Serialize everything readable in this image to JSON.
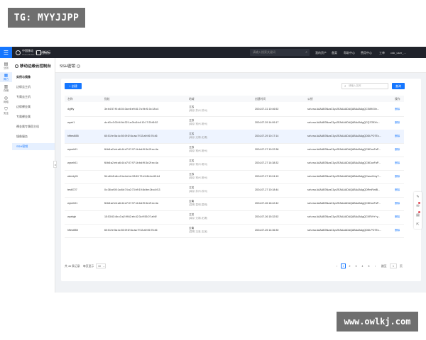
{
  "watermarks": {
    "top": "TG: MYYJJPP",
    "bottom": "www.owlkj.com"
  },
  "topbar": {
    "logo_text": "中国移动",
    "logo_sub": "China Mobile",
    "logo_text2": "移动云",
    "console_label": "控制台",
    "search_placeholder": "请输入搜索关键词",
    "nav": [
      "我的资产",
      "备案",
      "帮助中心",
      "费用中心",
      "工单"
    ],
    "user": "csb_user_..."
  },
  "iconbar": {
    "items": [
      {
        "label": "业务",
        "icon": "document-icon"
      },
      {
        "label": "算力",
        "icon": "server-icon"
      },
      {
        "label": "存储",
        "icon": "storage-icon"
      },
      {
        "label": "网络",
        "icon": "network-icon"
      },
      {
        "label": "安全",
        "icon": "shield-icon"
      }
    ]
  },
  "sidebar": {
    "title": "移动边缘云控制台",
    "group": "实例与镜像",
    "items": [
      "边缘云主机",
      "专属云主机",
      "边缘裸金属",
      "专属裸金属",
      "裸金属专属宿主机",
      "镜像服务",
      "SSH密钥"
    ],
    "active_index": 6
  },
  "page": {
    "title": "SSH密钥"
  },
  "toolbar": {
    "create_label": "+ 创建",
    "search_placeholder": "请输入名称",
    "search_label": "查询"
  },
  "table": {
    "columns": [
      "名称",
      "指纹",
      "地域",
      "创建时间",
      "公钥",
      "操作"
    ],
    "rows": [
      {
        "name": "dyjfffy",
        "fingerprint": "3e:b4:57:f0:c6:04:3a:e8:e9:81:7a:9b:f1:0c:18:c4",
        "region": "江苏",
        "region_sub": "(南京   苏州-苏州)",
        "time": "2024-07-31 10:46:52",
        "key": "ssh-rsa AAAAB3NzaC1yc2EAAAADAQABAAAAgQCS89OXn...",
        "op": "删除"
      },
      {
        "name": "wyzh1",
        "fingerprint": "dc:b3:c3:00:f4:9d:32:1a:0f:c5:b4:10:17:20:f6:52",
        "region": "江苏",
        "region_sub": "(南京   常州-常州)",
        "time": "2024-07-29 14:09:17",
        "key": "ssh-rsa AAAAB3NzaC1yc2EAAAADAQABAAAAgQCQ7O5Xh...",
        "op": "删除"
      },
      {
        "name": "hfttest555",
        "fingerprint": "60:51:fe:5a:4c:50:0f:f2:6c:aa:7f:33:a9:06:76:46",
        "region": "江苏",
        "region_sub": "(南京   无锡-无锡)",
        "time": "2024-07-29 10:17:14",
        "key": "ssh-rsa AAAAB3NzaC1yc2EAAAADAQABAAAAgQDDLPO7Ec...",
        "op": "删除"
      },
      {
        "name": "wyceh01",
        "fingerprint": "f8:b8:a2:eb:a6:44:d7:07:97:1b:bd:f9:3d:2f:ec:4a",
        "region": "江苏",
        "region_sub": "(南京   常州-常州)",
        "time": "2024-07-27 10:22:38",
        "key": "ssh-rsa AAAAB3NzaC1yc2EAAAADAQABAAAAgQCNDuvFaP...",
        "op": "删除"
      },
      {
        "name": "wyceh01",
        "fingerprint": "f8:b8:a2:eb:a6:44:d7:07:97:1b:bd:f9:3d:2f:ec:4a",
        "region": "江苏",
        "region_sub": "(南京   常州-常州)",
        "time": "2024-07-27 14:38:32",
        "key": "ssh-rsa AAAAB3NzaC1yc2EAAAADAQABAAAAgQCNDuvFaP...",
        "op": "删除"
      },
      {
        "name": "wlmnly01",
        "fingerprint": "54:c8:b5:db:c2:bc:be:be:53:63:72:d1:6b:bc:63:b4",
        "region": "江苏",
        "region_sub": "(南京   常州-常州)",
        "time": "2024-07-27 10:24:10",
        "key": "ssh-rsa AAAAB3NzaC1yc2EAAAADAQABAAAAgQCwuzHmy7...",
        "op": "删除"
      },
      {
        "name": "test0727",
        "fingerprint": "0c:38:af:00:1a:6d:74:a2:73:b9:19:8d:be:2b:c4:f13",
        "region": "江苏",
        "region_sub": "(南京   苏州-苏州)",
        "time": "2024-07-27 10:18:44",
        "key": "ssh-rsa AAAAB3NzaC1yc2EAAAADAQABAAAAgQDRrsRvdB...",
        "op": "删除"
      },
      {
        "name": "wyceh01",
        "fingerprint": "f8:b8:a2:eb:a6:44:d7:07:97:1b:bd:f9:3d:2f:ec:4a",
        "region": "云南",
        "region_sub": "(昆明   昆明-昆明)",
        "time": "2024-07-26 16:42:42",
        "key": "ssh-rsa AAAAB3NzaC1yc2EAAAADAQABAAAAgQCNDuvFaP...",
        "op": "删除"
      },
      {
        "name": "wyzbgh",
        "fingerprint": "15:53:63:4b:c3:a2:9f:62:eb:42:3c:ff:55:07:af:6f",
        "region": "江苏",
        "region_sub": "(南京   无锡-无锡)",
        "time": "2024-07-26 15:32:52",
        "key": "ssh-rsa AAAAB3NzaC1yc2EAAAADAQABAAAAgQCKRVrY+y...",
        "op": "删除"
      },
      {
        "name": "hftest555",
        "fingerprint": "60:51:fe:5a:4c:50:0f:f2:6c:aa:7f:33:a9:06:76:46",
        "region": "云南",
        "region_sub": "(昆明   玉溪-玉溪)",
        "time": "2024-07-25 14:36:30",
        "key": "ssh-rsa AAAAB3NzaC1yc2EAAAADAQABAAAAgQDDLPO7Ec...",
        "op": "删除"
      }
    ]
  },
  "pagination": {
    "total": "共 46 条记录",
    "page_size_label": "每页显示",
    "page_size": "10",
    "prev": "‹",
    "pages": [
      "1",
      "2",
      "3",
      "4",
      "5"
    ],
    "current": "1",
    "next": "›",
    "goto_label": "跳至",
    "goto_value": "1",
    "page_unit": "页"
  },
  "float_bar": {
    "items": [
      {
        "icon": "edit-icon",
        "badge": false
      },
      {
        "icon": "message-icon",
        "badge": true
      },
      {
        "icon": "document-icon",
        "badge": true
      },
      {
        "icon": "share-icon",
        "badge": false
      }
    ]
  }
}
